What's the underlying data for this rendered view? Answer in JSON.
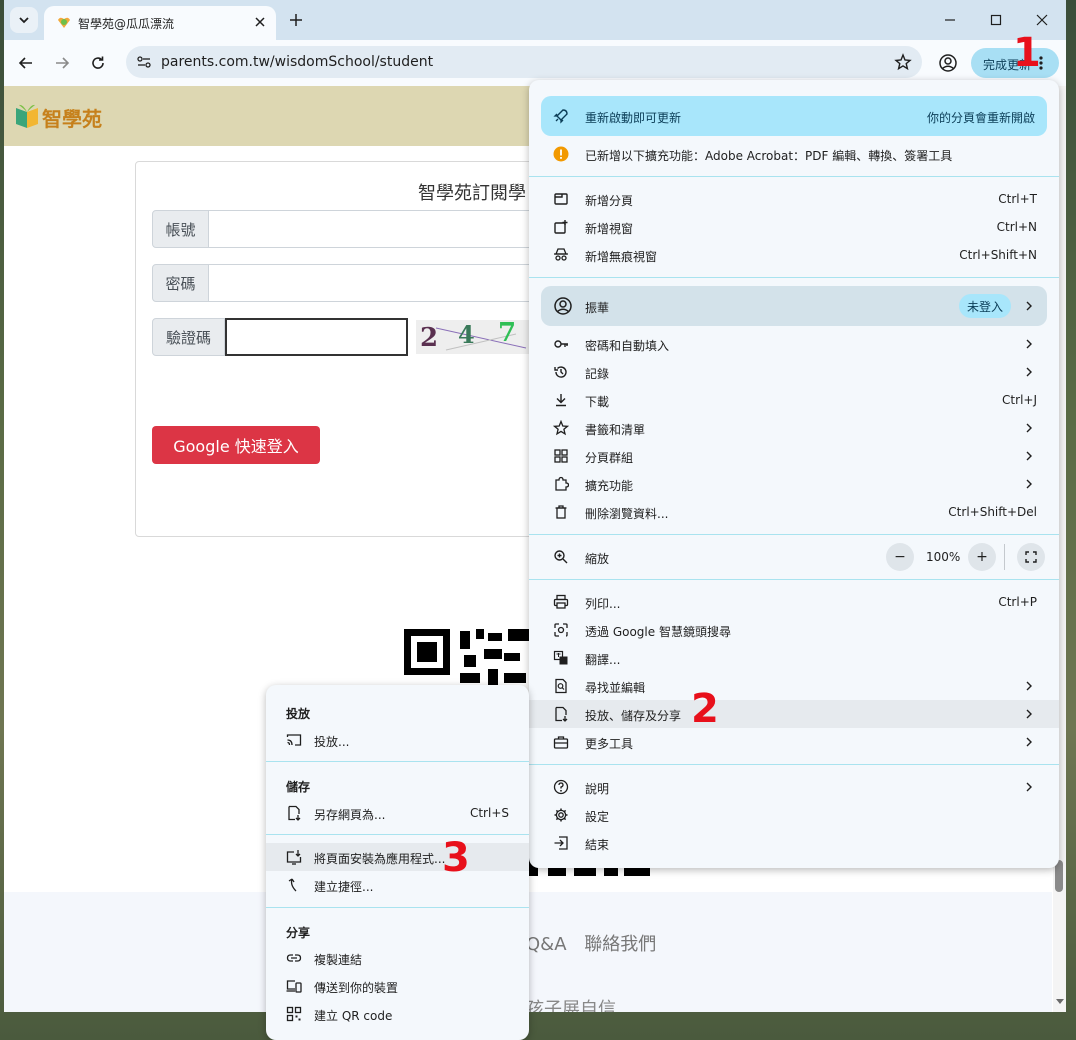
{
  "browser": {
    "tab_title": "智學苑@瓜瓜漂流",
    "url": "parents.com.tw/wisdomSchool/student",
    "update_button_label": "完成更新"
  },
  "site": {
    "logo_text": "智學苑",
    "card_title": "智學苑訂閱學",
    "account_label": "帳號",
    "password_label": "密碼",
    "captcha_label": "驗證碼",
    "captcha_digits": [
      "2",
      "4",
      "7"
    ],
    "google_login_label": "Google 快速登入",
    "footer_links": [
      "Q&A",
      "聯絡我們"
    ],
    "footer_slogan": "孩子展自信"
  },
  "menu": {
    "update_banner": {
      "label": "重新啟動即可更新",
      "note": "你的分頁會重新開啟"
    },
    "extension_notice": "已新增以下擴充功能：Adobe Acrobat：PDF 編輯、轉換、簽署工具",
    "new_tab": {
      "label": "新增分頁",
      "shortcut": "Ctrl+T"
    },
    "new_window": {
      "label": "新增視窗",
      "shortcut": "Ctrl+N"
    },
    "new_incognito": {
      "label": "新增無痕視窗",
      "shortcut": "Ctrl+Shift+N"
    },
    "profile": {
      "name": "振華",
      "status": "未登入"
    },
    "passwords": {
      "label": "密碼和自動填入"
    },
    "history": {
      "label": "記錄"
    },
    "downloads": {
      "label": "下載",
      "shortcut": "Ctrl+J"
    },
    "bookmarks": {
      "label": "書籤和清單"
    },
    "tab_groups": {
      "label": "分頁群組"
    },
    "extensions": {
      "label": "擴充功能"
    },
    "clear_data": {
      "label": "刪除瀏覽資料...",
      "shortcut": "Ctrl+Shift+Del"
    },
    "zoom": {
      "label": "縮放",
      "value": "100%",
      "minus": "−",
      "plus": "+"
    },
    "print": {
      "label": "列印...",
      "shortcut": "Ctrl+P"
    },
    "lens": {
      "label": "透過 Google 智慧鏡頭搜尋"
    },
    "translate": {
      "label": "翻譯..."
    },
    "find_edit": {
      "label": "尋找並編輯"
    },
    "cast_save_share": {
      "label": "投放、儲存及分享"
    },
    "more_tools": {
      "label": "更多工具"
    },
    "help": {
      "label": "說明"
    },
    "settings": {
      "label": "設定"
    },
    "exit": {
      "label": "結束"
    }
  },
  "submenu": {
    "cast_heading": "投放",
    "cast": {
      "label": "投放..."
    },
    "save_heading": "儲存",
    "save_page": {
      "label": "另存網頁為...",
      "shortcut": "Ctrl+S"
    },
    "install_app": {
      "label": "將頁面安裝為應用程式..."
    },
    "create_shortcut": {
      "label": "建立捷徑..."
    },
    "share_heading": "分享",
    "copy_link": {
      "label": "複製連結"
    },
    "send_to_devices": {
      "label": "傳送到你的裝置"
    },
    "create_qr": {
      "label": "建立 QR code"
    }
  },
  "annotations": [
    "1",
    "2",
    "3"
  ],
  "colors": {
    "accent_banner": "#a8e6fb",
    "google_button": "#dc3545",
    "site_header": "#ddd7b2",
    "annotation": "#e8101b"
  }
}
